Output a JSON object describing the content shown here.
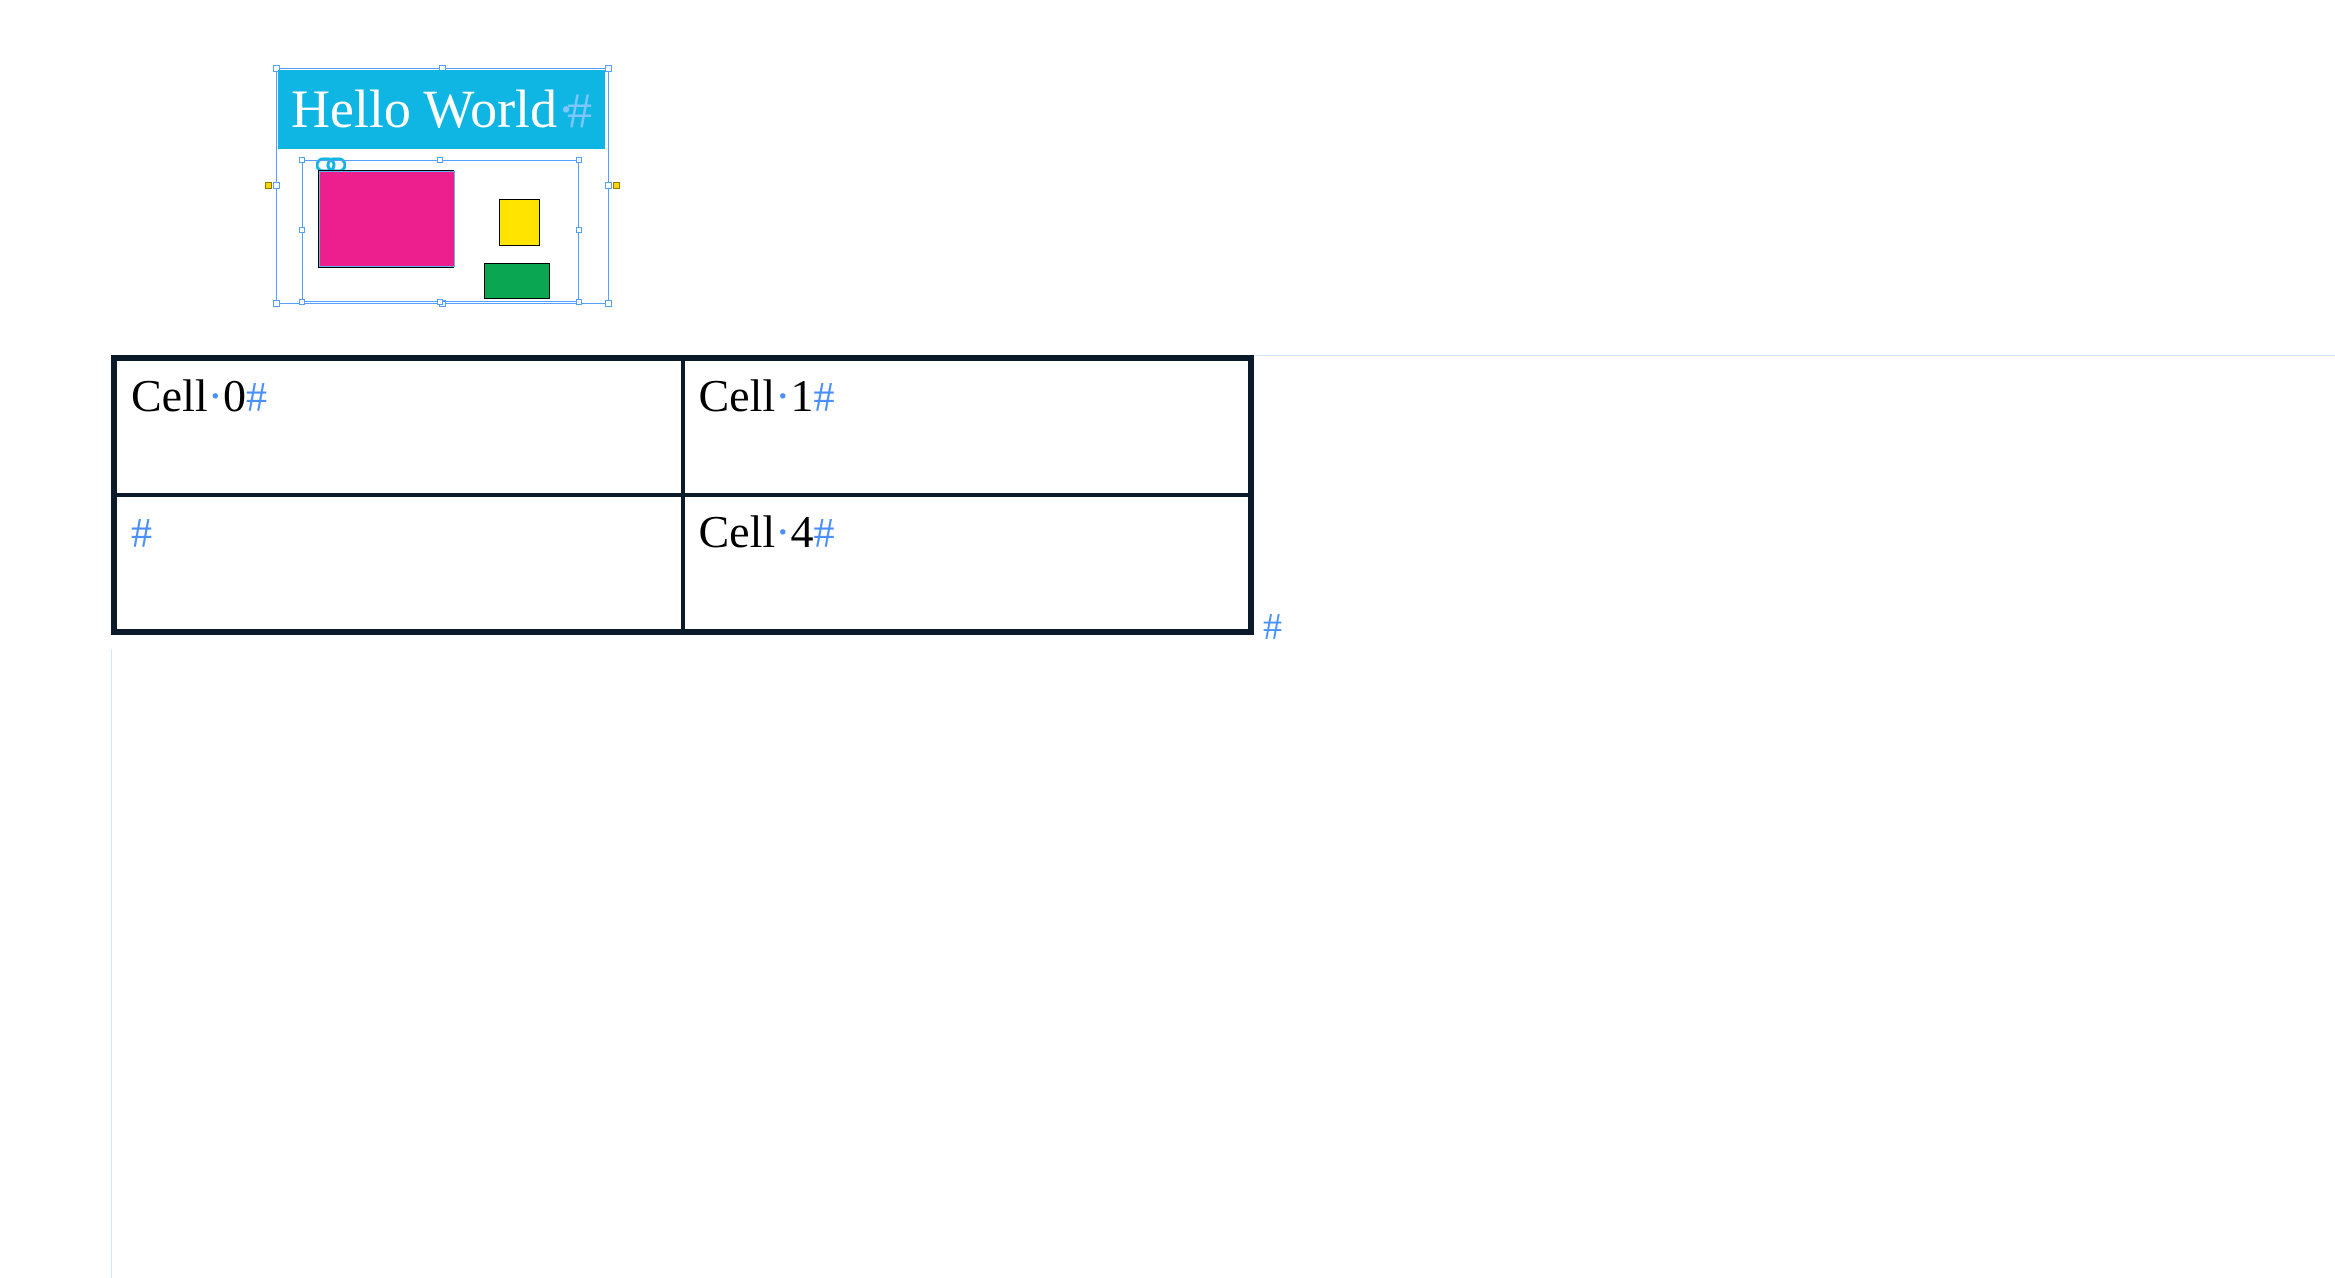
{
  "banner": {
    "text": "Hello World",
    "bg": "#0fb6e4",
    "fg": "#ffffff"
  },
  "anchor_icon_name": "chain-icon",
  "linked_object": {
    "shapes": [
      {
        "kind": "rect",
        "fill": "#ed1e8e",
        "stroke": "#5bb5ef",
        "role": "pink-rect"
      },
      {
        "kind": "rect",
        "fill": "#ffe400",
        "stroke": "#000000",
        "role": "yellow-rect"
      },
      {
        "kind": "rect",
        "fill": "#0aa651",
        "stroke": "#000000",
        "role": "green-rect"
      }
    ]
  },
  "table": {
    "rows": 2,
    "cols": 2,
    "cells": {
      "r0c0": "Cell 0",
      "r0c1": "Cell 1",
      "r1c0": "",
      "r1c1": "Cell 4"
    }
  },
  "glyphs": {
    "space_dot": "·",
    "para": "#"
  }
}
